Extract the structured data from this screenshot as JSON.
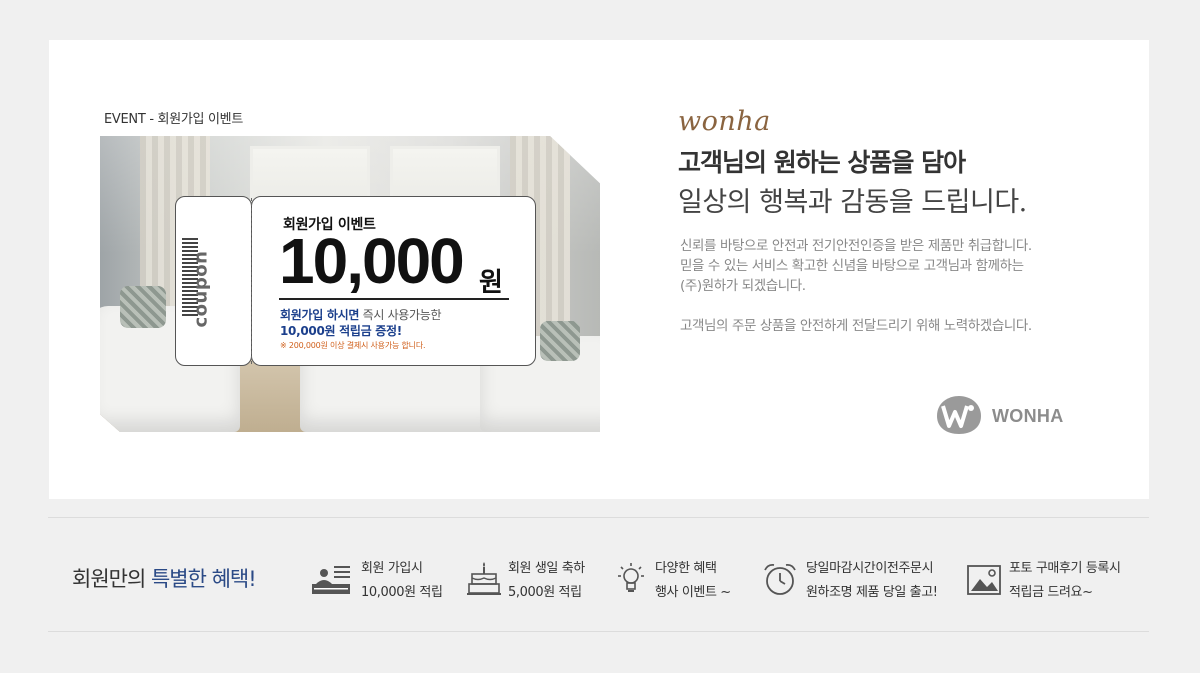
{
  "event": {
    "label": "EVENT - 회원가입 이벤트"
  },
  "coupon": {
    "stub_text": "coupon",
    "title": "회원가입 이벤트",
    "amount": "10,000",
    "unit": "원",
    "desc_strong": "회원가입 하시면",
    "desc_light": " 즉시 사용가능한",
    "desc2": "10,000원 적립금 증정!",
    "note": "※ 200,000원 이상 결제시 사용가능 합니다."
  },
  "intro": {
    "brand_script": "wonha",
    "headline": "고객님의 원하는 상품을 담아",
    "subline": "일상의 행복과 감동을 드립니다.",
    "paragraph1": [
      "신뢰를 바탕으로 안전과 전기안전인증을 받은 제품만 취급합니다.",
      "믿을 수 있는 서비스 확고한 신념을 바탕으로 고객님과 함께하는",
      "(주)원하가 되겠습니다."
    ],
    "paragraph2": "고객님의 주문 상품을 안전하게 전달드리기 위해 노력하겠습니다."
  },
  "logo": {
    "text": "WONHA",
    "color": "#8c8c8c"
  },
  "benefits": {
    "title_prefix": "회원만의 ",
    "title_accent": "특별한 혜택!",
    "accent_color": "#2b4a86",
    "items": [
      {
        "icon": "podium-icon",
        "line1": "회원 가입시",
        "line2": "10,000원 적립"
      },
      {
        "icon": "cake-icon",
        "line1": "회원 생일 축하",
        "line2": "5,000원 적립"
      },
      {
        "icon": "lightbulb-icon",
        "line1": "다양한 혜택",
        "line2": "행사 이벤트 ~"
      },
      {
        "icon": "alarm-clock-icon",
        "line1": "당일마감시간이전주문시",
        "line2": "원하조명 제품 당일 출고!"
      },
      {
        "icon": "photo-icon",
        "line1": "포토 구매후기 등록시",
        "line2": "적립금 드려요~"
      }
    ]
  }
}
